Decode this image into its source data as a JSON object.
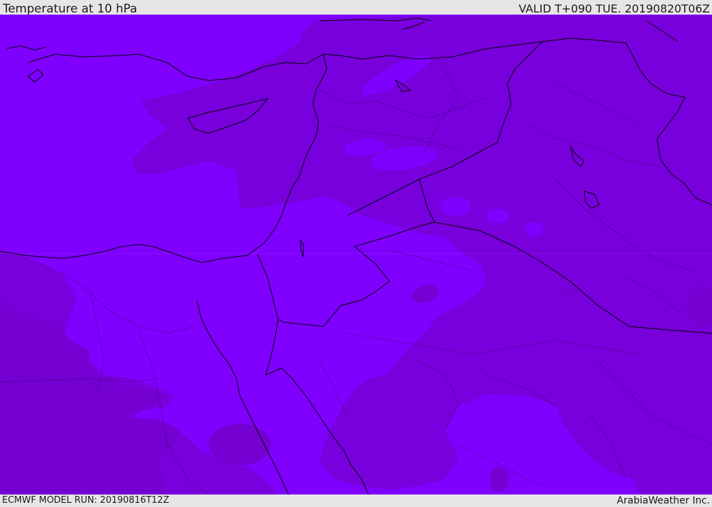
{
  "header": {
    "title": "Temperature at 10 hPa",
    "valid": "VALID T+090 TUE. 20190820T06Z"
  },
  "footer": {
    "model_run": "ECMWF MODEL RUN: 20190816T12Z",
    "credit": "ArabiaWeather Inc."
  },
  "colors": {
    "field_light": "#7f00ff",
    "field_dark": "#7800dc",
    "field_darker": "#7400d2",
    "coastline": "#000000",
    "border": "#000000",
    "bars": "#e6e6e6"
  }
}
